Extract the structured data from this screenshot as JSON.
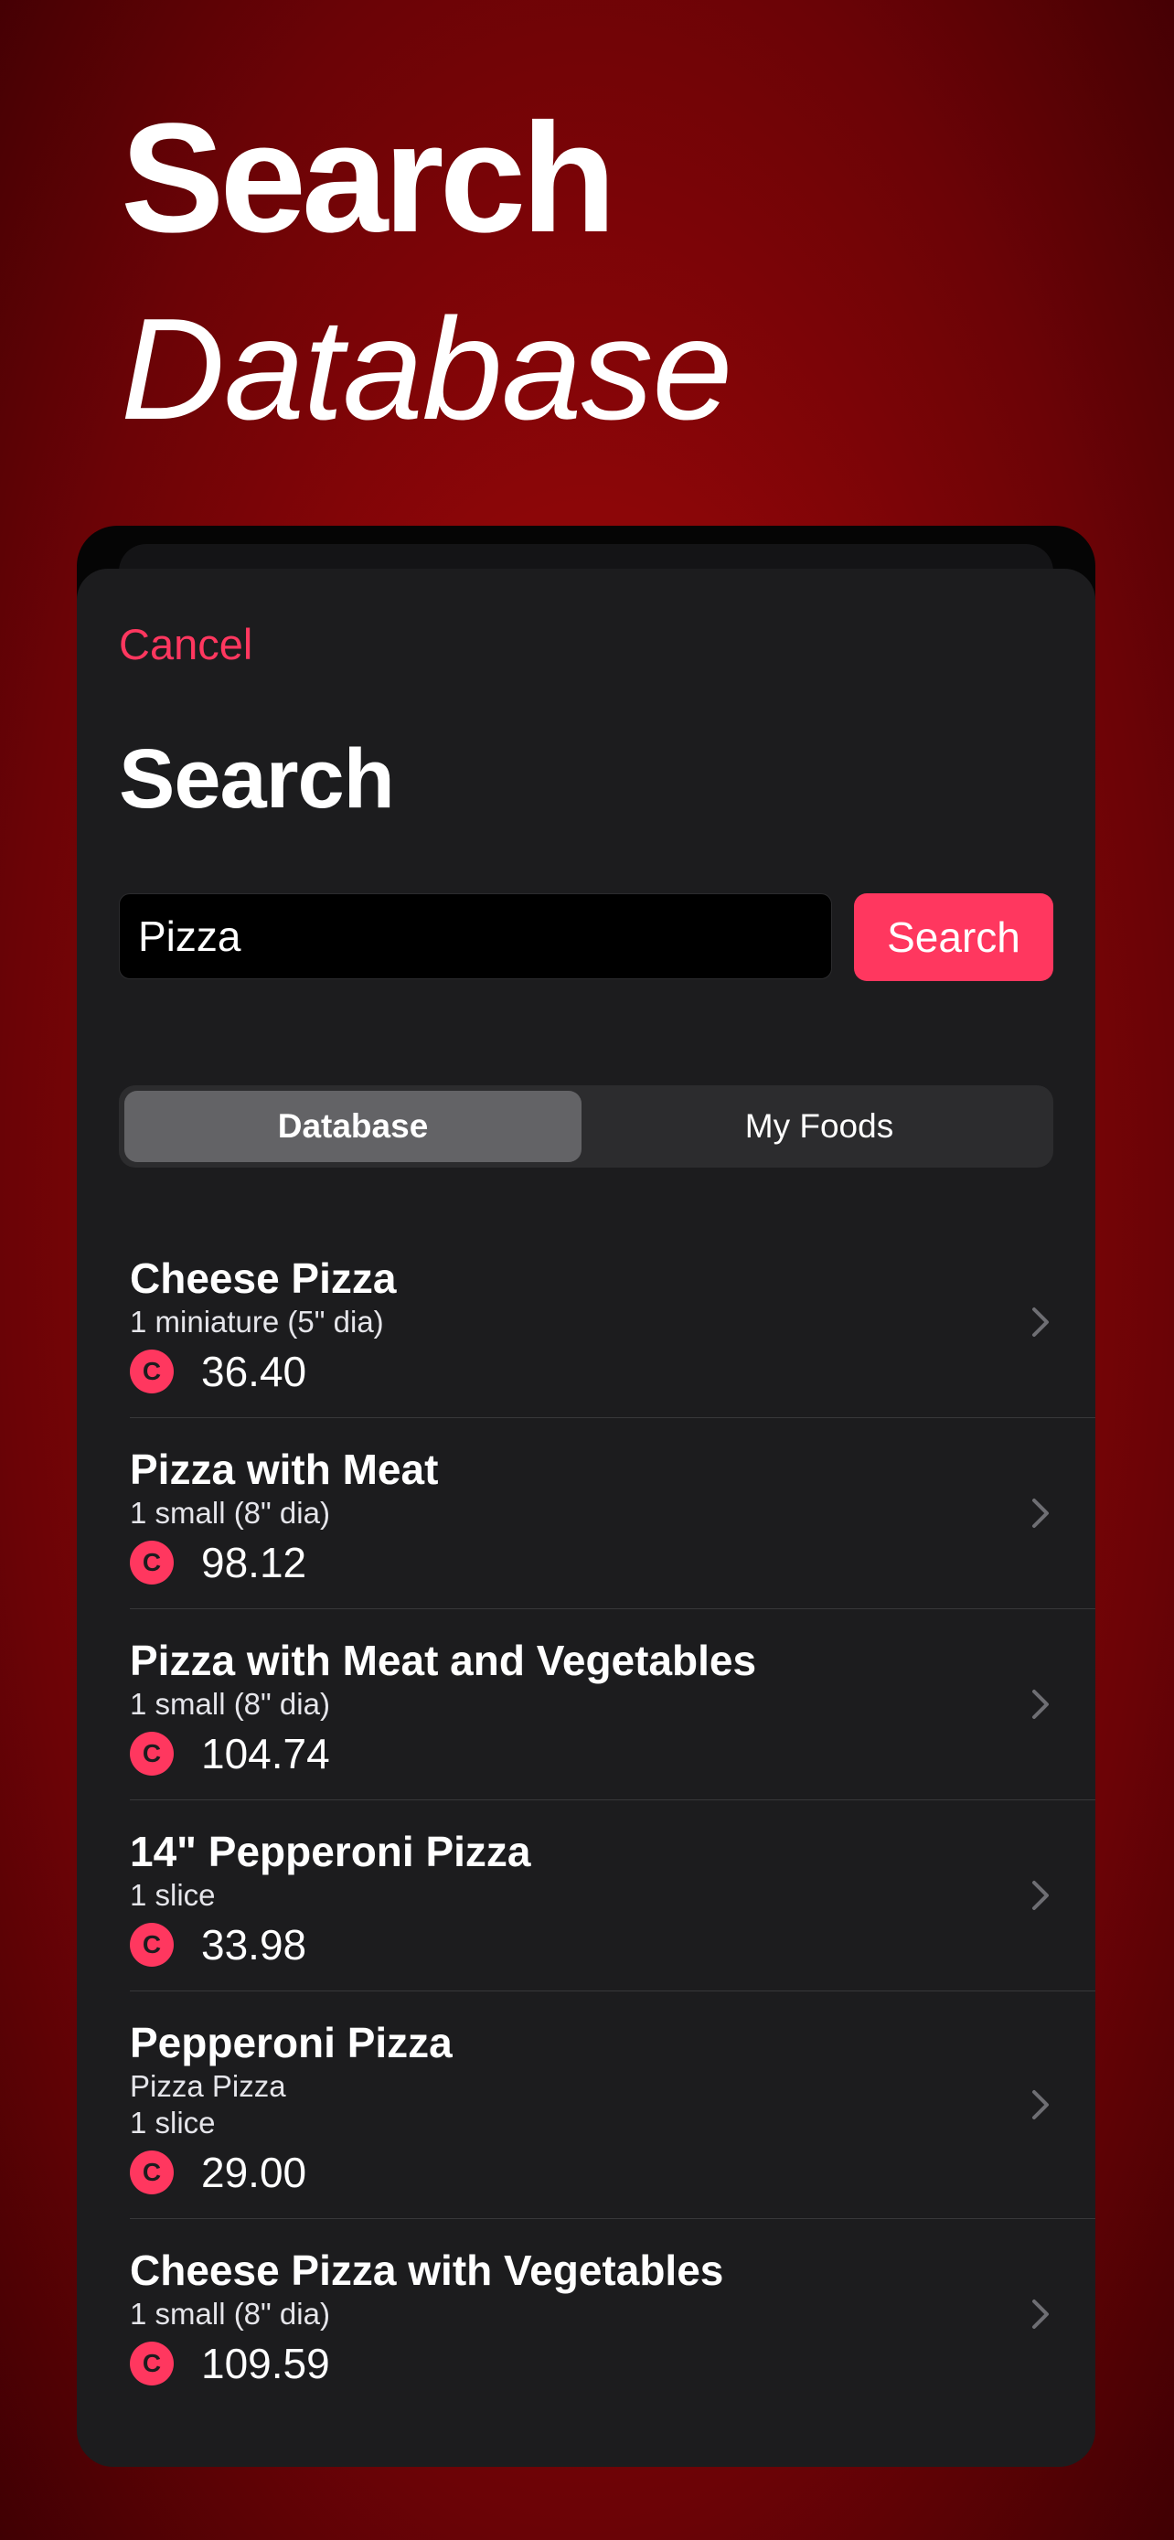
{
  "hero": {
    "line1": "Search",
    "line2": "Database"
  },
  "sheet": {
    "cancel_label": "Cancel",
    "title": "Search",
    "search_value": "Pizza",
    "search_button_label": "Search",
    "segments": [
      "Database",
      "My Foods"
    ],
    "selected_segment": "Database"
  },
  "results": [
    {
      "name": "Cheese Pizza",
      "details": [
        "1 miniature (5\" dia)"
      ],
      "calories": "36.40"
    },
    {
      "name": "Pizza with Meat",
      "details": [
        "1 small (8\" dia)"
      ],
      "calories": "98.12"
    },
    {
      "name": "Pizza with Meat and Vegetables",
      "details": [
        "1 small (8\" dia)"
      ],
      "calories": "104.74"
    },
    {
      "name": "14\" Pepperoni Pizza",
      "details": [
        "1 slice"
      ],
      "calories": "33.98"
    },
    {
      "name": "Pepperoni Pizza",
      "details": [
        "Pizza Pizza",
        "1 slice"
      ],
      "calories": "29.00"
    },
    {
      "name": "Cheese Pizza with Vegetables",
      "details": [
        "1 small (8\" dia)"
      ],
      "calories": "109.59"
    }
  ],
  "calorie_badge_letter": "C",
  "colors": {
    "accent": "#ff375f",
    "sheet": "#1c1c1e",
    "background": "#8f0608"
  },
  "icons": {
    "row_accessory": "chevron-right-icon",
    "calorie": "calorie-badge-icon"
  }
}
